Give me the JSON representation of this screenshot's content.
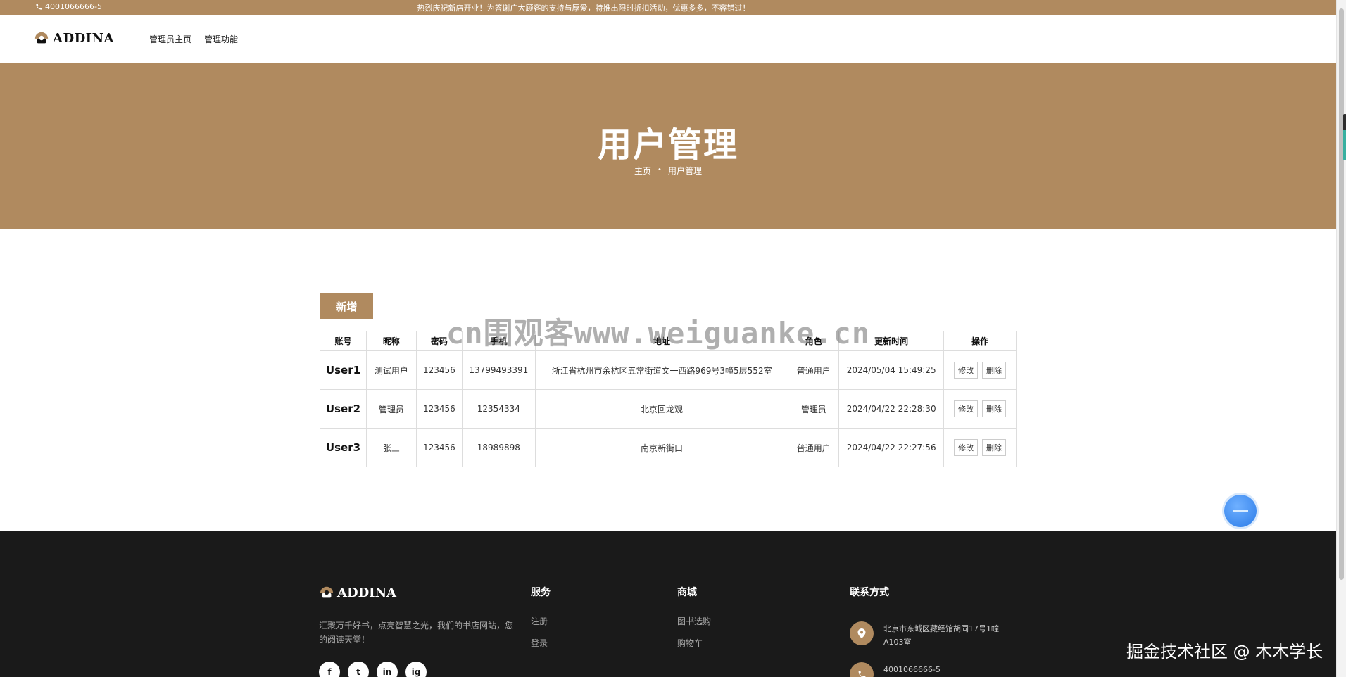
{
  "topbar": {
    "phone": "4001066666-5",
    "notice": "热烈庆祝新店开业！为答谢广大顾客的支持与厚爱，特推出限时折扣活动，优惠多多，不容错过！",
    "phone_icon": "phone-icon"
  },
  "nav": {
    "brand": "ADDINA",
    "menu": [
      "管理员主页",
      "管理功能"
    ]
  },
  "hero": {
    "title": "用户管理",
    "breadcrumb": [
      "主页",
      "•",
      "用户管理"
    ]
  },
  "actions": {
    "add": "新增"
  },
  "table": {
    "headers": [
      "账号",
      "昵称",
      "密码",
      "手机",
      "地址",
      "角色",
      "更新时间",
      "操作"
    ],
    "rows": [
      {
        "account": "User1",
        "nickname": "测试用户",
        "password": "123456",
        "phone": "13799493391",
        "address": "浙江省杭州市余杭区五常街道文一西路969号3幢5层552室",
        "role": "普通用户",
        "updated": "2024/05/04 15:49:25",
        "edit": "修改",
        "delete": "删除"
      },
      {
        "account": "User2",
        "nickname": "管理员",
        "password": "123456",
        "phone": "12354334",
        "address": "北京回龙观",
        "role": "管理员",
        "updated": "2024/04/22 22:28:30",
        "edit": "修改",
        "delete": "删除"
      },
      {
        "account": "User3",
        "nickname": "张三",
        "password": "123456",
        "phone": "18989898",
        "address": "南京新街口",
        "role": "普通用户",
        "updated": "2024/04/22 22:27:56",
        "edit": "修改",
        "delete": "删除"
      }
    ]
  },
  "watermark": "cn围观客www.weiguanke.cn",
  "footer": {
    "brand": "ADDINA",
    "description": "汇聚万千好书，点亮智慧之光，我们的书店网站，您的阅读天堂！",
    "socials": [
      "f",
      "t",
      "in",
      "ig"
    ],
    "services_title": "服务",
    "services": [
      "注册",
      "登录"
    ],
    "mall_title": "商城",
    "mall": [
      "图书选购",
      "购物车"
    ],
    "contact_title": "联系方式",
    "address": "北京市东城区藏经馆胡同17号1幢A103室",
    "phone": "4001066666-5"
  },
  "credit": "掘金技术社区 @ 木木学长",
  "colors": {
    "brand": "#b08a5f",
    "footer": "#1a1a1a"
  }
}
